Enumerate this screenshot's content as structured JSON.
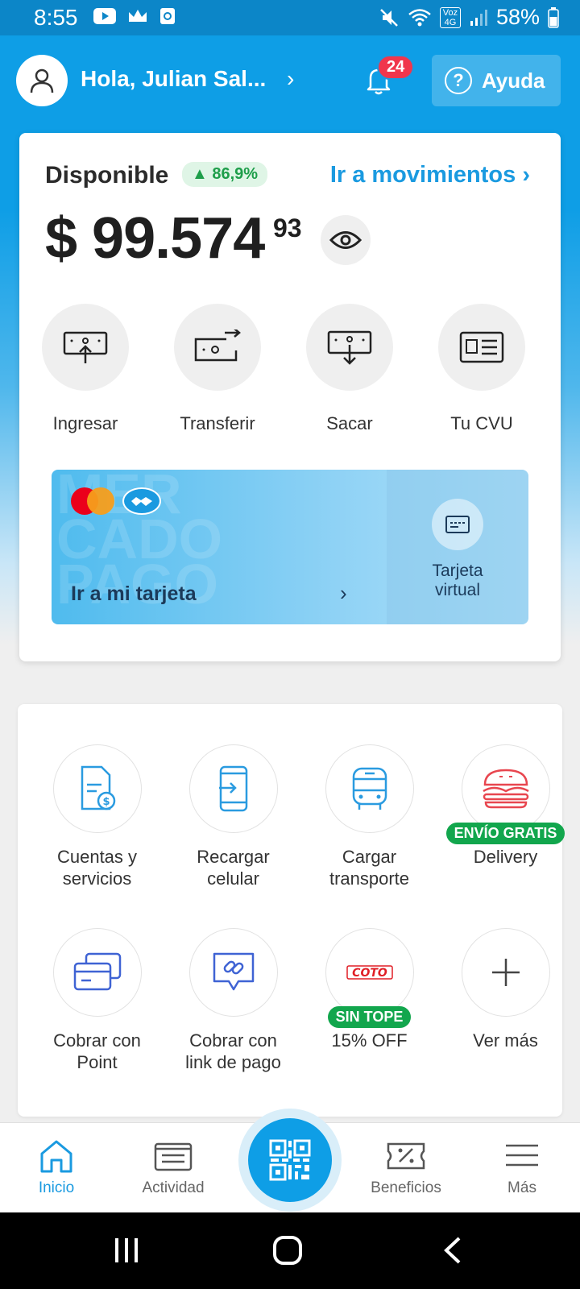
{
  "status_bar": {
    "time": "8:55",
    "network_label": "Voz 4G",
    "battery": "58%"
  },
  "header": {
    "greeting": "Hola, Julian Sal...",
    "notifications_count": "24",
    "help_label": "Ayuda"
  },
  "balance": {
    "label": "Disponible",
    "change": "▲ 86,9%",
    "movements_link": "Ir a movimientos",
    "amount": "$ 99.574",
    "cents": "93"
  },
  "actions": [
    {
      "label": "Ingresar",
      "icon": "deposit-icon"
    },
    {
      "label": "Transferir",
      "icon": "transfer-icon"
    },
    {
      "label": "Sacar",
      "icon": "withdraw-icon"
    },
    {
      "label": "Tu CVU",
      "icon": "id-card-icon"
    }
  ],
  "card": {
    "watermark": "MER CADO PAGO",
    "link": "Ir a mi tarjeta",
    "virtual_label": "Tarjeta virtual"
  },
  "services": [
    {
      "label": "Cuentas y servicios",
      "icon": "bill-icon"
    },
    {
      "label": "Recargar celular",
      "icon": "phone-recharge-icon"
    },
    {
      "label": "Cargar transporte",
      "icon": "bus-icon"
    },
    {
      "label": "Delivery",
      "icon": "burger-icon",
      "tag": "ENVÍO GRATIS"
    },
    {
      "label": "Cobrar con Point",
      "icon": "point-device-icon"
    },
    {
      "label": "Cobrar con link de pago",
      "icon": "payment-link-icon"
    },
    {
      "label": "15% OFF",
      "icon": "coto-logo",
      "tag": "SIN TOPE",
      "logo_text": "COTO"
    },
    {
      "label": "Ver más",
      "icon": "plus-icon"
    }
  ],
  "bottom_nav": [
    {
      "label": "Inicio",
      "icon": "home-icon",
      "active": true
    },
    {
      "label": "Actividad",
      "icon": "activity-icon"
    },
    {
      "label": "Beneficios",
      "icon": "discount-icon"
    },
    {
      "label": "Más",
      "icon": "menu-icon"
    }
  ],
  "colors": {
    "brand": "#0e9ee6",
    "link": "#1a9ae0",
    "badge": "#f0364c",
    "tag_green": "#12a64d"
  }
}
